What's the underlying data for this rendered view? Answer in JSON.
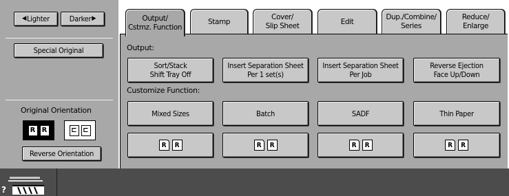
{
  "density": {
    "lighter_label": "Lighter",
    "darker_label": "Darker"
  },
  "left": {
    "special_original_label": "Special Original",
    "orientation_title": "Original Orientation",
    "orientation_portrait_glyph": "R",
    "orientation_landscape_glyph": "⊏",
    "reverse_orientation_label": "Reverse Orientation"
  },
  "tabs": [
    {
      "label": "Output/\nCstmz. Function",
      "active": true
    },
    {
      "label": "Stamp",
      "active": false
    },
    {
      "label": "Cover/\nSlip Sheet",
      "active": false
    },
    {
      "label": "Edit",
      "active": false
    },
    {
      "label": "Dup./Combine/\nSeries",
      "active": false
    },
    {
      "label": "Reduce/\nEnlarge",
      "active": false
    }
  ],
  "output": {
    "section_label": "Output:",
    "buttons": [
      {
        "label": "Sort/Stack\nShift Tray Off"
      },
      {
        "label": "Insert Separation Sheet\nPer    1 set(s)"
      },
      {
        "label": "Insert Separation Sheet\nPer Job"
      },
      {
        "label": "Reverse Ejection\nFace Up/Down"
      }
    ]
  },
  "customize": {
    "section_label": "Customize Function:",
    "buttons": [
      {
        "label": "Mixed Sizes"
      },
      {
        "label": "Batch"
      },
      {
        "label": "SADF"
      },
      {
        "label": "Thin Paper"
      }
    ],
    "icon_glyph": "R"
  },
  "status": {
    "help_glyph": "?"
  },
  "colors": {
    "panel_gray": "#a8a8a8",
    "button_gray": "#c8c8c8",
    "bottom_bar": "#4c4c4c"
  }
}
